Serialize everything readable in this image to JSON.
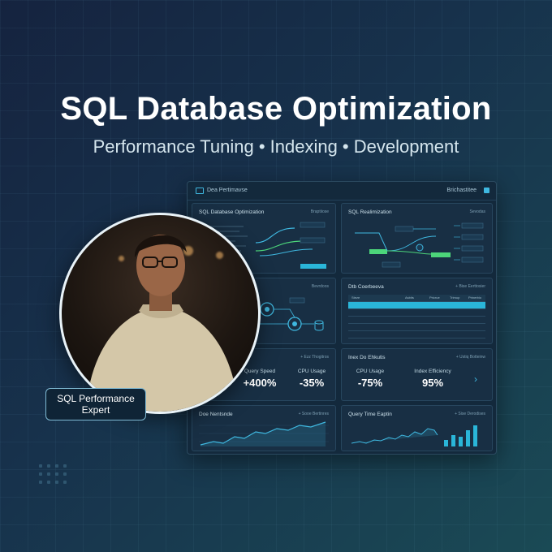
{
  "hero": {
    "title": "SQL Database Optimization",
    "subtitle": "Performance Tuning • Indexing • Development"
  },
  "dashboard": {
    "title": "Dea Pertimavse",
    "right_label": "Brichastitee",
    "panels": {
      "optimization": {
        "title": "SQL Database Optimization",
        "link": "Braptiiose"
      },
      "realization": {
        "title": "SQL Realimization",
        "link": "Sevodas"
      },
      "diagram": {
        "title": "",
        "link": "Bevrdoos"
      },
      "table": {
        "title": "Dtb Coerbeeva",
        "link": "+ Bise Eerttosier",
        "columns": [
          "Steze",
          "Asbits",
          "Pricrue",
          "Trimup",
          "Prinerbio"
        ]
      },
      "metrics_left": {
        "title": "",
        "link": "+ Ezz Thogitros",
        "items": [
          {
            "label": "Query Speed",
            "value": "+400%"
          },
          {
            "label": "CPU Usage",
            "value": "-35%"
          }
        ]
      },
      "metrics_right": {
        "title": "Inex Do Ehkutis",
        "link": "+ Ustiq Botteinw",
        "items": [
          {
            "label": "CPU Usage",
            "value": "-75%"
          },
          {
            "label": "Index Efficiency",
            "value": "95%"
          }
        ]
      },
      "line_panel": {
        "title": "Doe Nentsnde",
        "link": "+ Sooe Bertinres"
      },
      "query_panel": {
        "title": "Query Time Eaptin",
        "link": "+ Sise Derodises"
      }
    }
  },
  "badge": {
    "text": "SQL Performance Expert"
  },
  "colors": {
    "accent": "#3fb8e0",
    "green": "#4cd57a",
    "bg": "#15233f"
  }
}
